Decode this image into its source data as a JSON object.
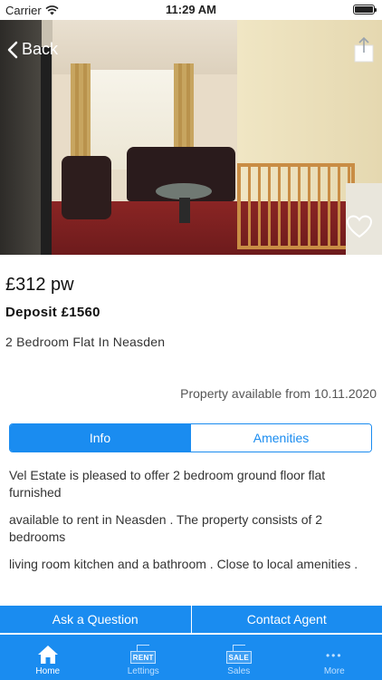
{
  "status_bar": {
    "carrier": "Carrier",
    "time": "11:29 AM",
    "battery_level": 0.95
  },
  "hero": {
    "back_label": "Back",
    "icons": [
      "chevron-left-icon",
      "share-icon",
      "heart-icon"
    ]
  },
  "listing": {
    "price": "£312 pw",
    "deposit": "Deposit £1560",
    "title": "2 Bedroom Flat In Neasden",
    "available": "Property available from 10.11.2020"
  },
  "tabs": {
    "info": "Info",
    "amenities": "Amenities",
    "selected": "Info"
  },
  "description": [
    "Vel Estate is pleased to offer 2 bedroom ground floor flat furnished",
    "available to rent in Neasden . The property consists of 2 bedrooms",
    "living room  kitchen and a bathroom  . Close to local amenities ."
  ],
  "actions": {
    "ask": "Ask a Question",
    "contact": "Contact Agent"
  },
  "tab_bar": {
    "items": [
      {
        "label": "Home",
        "icon": "home-icon",
        "badge": ""
      },
      {
        "label": "Lettings",
        "icon": "rent-sign-icon",
        "badge": "RENT"
      },
      {
        "label": "Sales",
        "icon": "sale-sign-icon",
        "badge": "SALE"
      },
      {
        "label": "More",
        "icon": "more-dots-icon",
        "badge": ""
      }
    ],
    "active": "Home"
  },
  "colors": {
    "accent": "#1a8cf0",
    "tab_inactive": "#bfe0ff"
  }
}
